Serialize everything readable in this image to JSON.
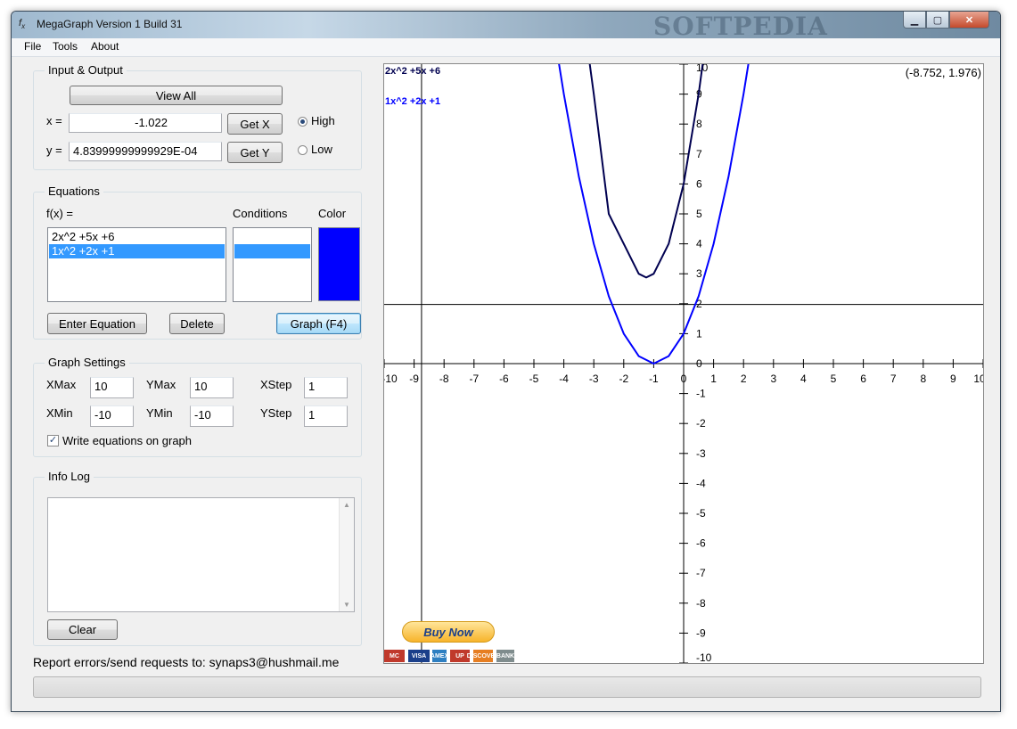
{
  "window": {
    "title": "MegaGraph Version 1 Build 31",
    "watermark": "SOFTPEDIA",
    "icon": "fx-app-icon"
  },
  "caption_buttons": {
    "minimize": "▁",
    "maximize": "▢",
    "close": "✕"
  },
  "menu": [
    "File",
    "Tools",
    "About"
  ],
  "io": {
    "group_label": "Input & Output",
    "view_all_label": "View All",
    "x_label": "x =",
    "x_value": "-1.022",
    "y_label": "y =",
    "y_value": "4.83999999999929E-04",
    "get_x_label": "Get X",
    "get_y_label": "Get Y",
    "precision_options": [
      "High",
      "Low"
    ],
    "precision_selected": "High"
  },
  "equations": {
    "group_label": "Equations",
    "fx_label": "f(x) =",
    "conditions_label": "Conditions",
    "color_label": "Color",
    "items": [
      {
        "expr": "2x^2 +5x +6",
        "condition": "",
        "color": "#000050",
        "selected": false
      },
      {
        "expr": "1x^2 +2x +1",
        "condition": "",
        "color": "#0000ff",
        "selected": true
      }
    ],
    "selected_color": "#0000ff",
    "enter_label": "Enter Equation",
    "delete_label": "Delete",
    "graph_label": "Graph (F4)"
  },
  "graph_settings": {
    "group_label": "Graph Settings",
    "xmax_label": "XMax",
    "xmax": "10",
    "ymax_label": "YMax",
    "ymax": "10",
    "xstep_label": "XStep",
    "xstep": "1",
    "xmin_label": "XMin",
    "xmin": "-10",
    "ymin_label": "YMin",
    "ymin": "-10",
    "ystep_label": "YStep",
    "ystep": "1",
    "write_eq_label": "Write equations on graph",
    "write_eq_checked": true
  },
  "info_log": {
    "group_label": "Info Log",
    "content": "",
    "clear_label": "Clear"
  },
  "footer_text": "Report errors/send requests to: synaps3@hushmail.me",
  "graph": {
    "coord_readout": "(-8.752, 1.976)",
    "eq_labels": [
      "2x^2 +5x +6",
      "1x^2 +2x +1"
    ],
    "x_tick_labels": [
      "-10",
      "-9",
      "-8",
      "-7",
      "-6",
      "-5",
      "-4",
      "-3",
      "-2",
      "-1",
      "0",
      "1",
      "2",
      "3",
      "4",
      "5",
      "6",
      "7",
      "8",
      "9",
      "10"
    ],
    "y_tick_labels": [
      "10",
      "9",
      "8",
      "7",
      "6",
      "5",
      "4",
      "3",
      "2",
      "1",
      "0",
      "-1",
      "-2",
      "-3",
      "-4",
      "-5",
      "-6",
      "-7",
      "-8",
      "-9",
      "-10"
    ],
    "crosshair": {
      "x": -8.752,
      "y": 1.976
    },
    "axis_color": "#000000",
    "curve_colors": [
      "#000050",
      "#0000ff"
    ]
  },
  "chart_data": {
    "type": "line",
    "title": "",
    "xlabel": "",
    "ylabel": "",
    "xlim": [
      -10,
      10
    ],
    "ylim": [
      -10,
      10
    ],
    "xstep": 1,
    "ystep": 1,
    "grid": false,
    "series": [
      {
        "name": "2x^2 +5x +6",
        "color": "#000050",
        "x": [
          -3.2,
          -3.0,
          -2.5,
          -2.0,
          -1.5,
          -1.25,
          -1.0,
          -0.5,
          0.0,
          0.5,
          0.7
        ],
        "y": [
          10.48,
          9.0,
          5.0,
          4.0,
          3.0,
          2.875,
          3.0,
          4.0,
          6.0,
          9.0,
          10.48
        ]
      },
      {
        "name": "1x^2 +2x +1",
        "color": "#0000ff",
        "x": [
          -4.2,
          -4.0,
          -3.5,
          -3.0,
          -2.5,
          -2.0,
          -1.5,
          -1.0,
          -0.5,
          0.0,
          0.5,
          1.0,
          1.5,
          2.0,
          2.2
        ],
        "y": [
          10.24,
          9.0,
          6.25,
          4.0,
          2.25,
          1.0,
          0.25,
          0.0,
          0.25,
          1.0,
          2.25,
          4.0,
          6.25,
          9.0,
          10.24
        ]
      }
    ]
  },
  "buy_now": {
    "label": "Buy Now",
    "cards": [
      {
        "text": "MC",
        "color": "#c0392b"
      },
      {
        "text": "VISA",
        "color": "#1a3f8a"
      },
      {
        "text": "AMEX",
        "color": "#2e7fc1"
      },
      {
        "text": "UP",
        "color": "#c0392b"
      },
      {
        "text": "DISCOVER",
        "color": "#e67e22"
      },
      {
        "text": "BANK",
        "color": "#7f8c8d"
      }
    ]
  }
}
